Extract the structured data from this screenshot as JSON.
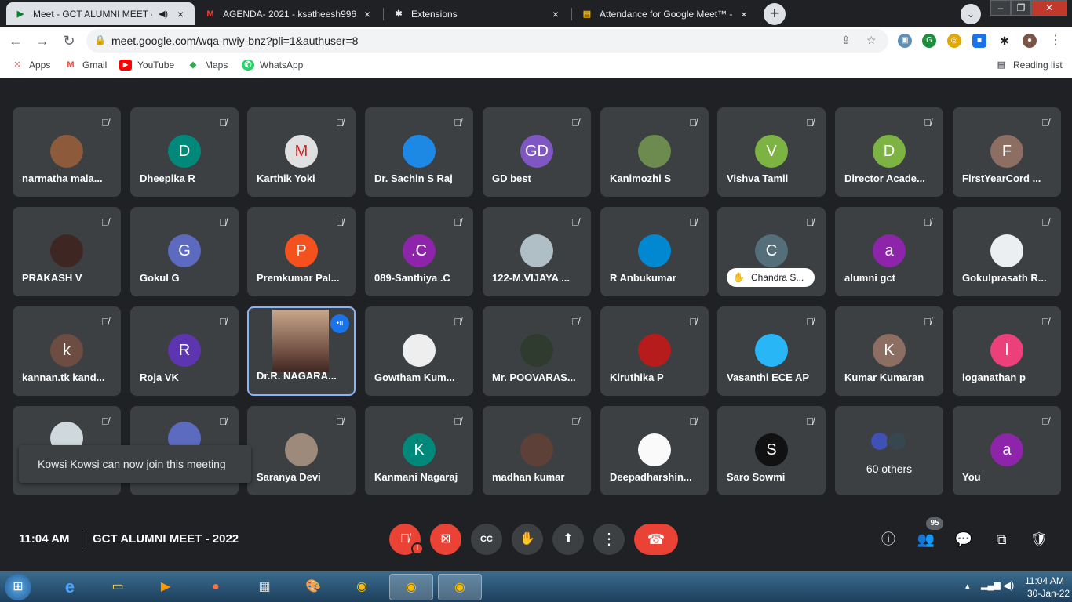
{
  "browser": {
    "tabs": [
      {
        "title": "Meet - GCT ALUMNI MEET -",
        "icon": "meet-icon"
      },
      {
        "title": "AGENDA- 2021 - ksatheesh996@",
        "icon": "gmail-icon"
      },
      {
        "title": "Extensions",
        "icon": "puzzle-icon"
      },
      {
        "title": "Attendance for Google Meet™ -",
        "icon": "attendance-icon"
      }
    ],
    "url": "meet.google.com/wqa-nwiy-bnz?pli=1&authuser=8",
    "bookmarks": [
      {
        "label": "Apps"
      },
      {
        "label": "Gmail"
      },
      {
        "label": "YouTube"
      },
      {
        "label": "Maps"
      },
      {
        "label": "WhatsApp"
      }
    ],
    "reading_list": "Reading list"
  },
  "participants": [
    {
      "name": "narmatha mala...",
      "initial": "",
      "color": "#8d5a3c"
    },
    {
      "name": "Dheepika R",
      "initial": "D",
      "color": "#00897b"
    },
    {
      "name": "Karthik Yoki",
      "initial": "M",
      "color": "#e0e0e0"
    },
    {
      "name": "Dr. Sachin S Raj",
      "initial": "",
      "color": "#1e88e5"
    },
    {
      "name": "GD best",
      "initial": "GD",
      "color": "#7e57c2"
    },
    {
      "name": "Kanimozhi S",
      "initial": "",
      "color": "#6d8b4f"
    },
    {
      "name": "Vishva Tamil",
      "initial": "V",
      "color": "#7cb342"
    },
    {
      "name": "Director Acade...",
      "initial": "D",
      "color": "#7cb342"
    },
    {
      "name": "FirstYearCord ...",
      "initial": "F",
      "color": "#8d6e63"
    },
    {
      "name": "PRAKASH V",
      "initial": "",
      "color": "#3e2723"
    },
    {
      "name": "Gokul G",
      "initial": "G",
      "color": "#5c6bc0"
    },
    {
      "name": "Premkumar Pal...",
      "initial": "P",
      "color": "#f4511e"
    },
    {
      "name": "089-Santhiya .C",
      "initial": ".C",
      "color": "#8e24aa"
    },
    {
      "name": "122-M.VIJAYA ...",
      "initial": "",
      "color": "#b0bec5"
    },
    {
      "name": "R Anbukumar",
      "initial": "",
      "color": "#0288d1"
    },
    {
      "name": "Chandra S...",
      "initial": "C",
      "color": "#546e7a"
    },
    {
      "name": "alumni gct",
      "initial": "a",
      "color": "#8e24aa"
    },
    {
      "name": "Gokulprasath R...",
      "initial": "",
      "color": "#eceff1"
    },
    {
      "name": "kannan.tk kand...",
      "initial": "k",
      "color": "#6d4c41"
    },
    {
      "name": "Roja VK",
      "initial": "R",
      "color": "#5e35b1"
    },
    {
      "name": "Dr.R. NAGARA...",
      "initial": "",
      "color": "#a1887f"
    },
    {
      "name": "Gowtham Kum...",
      "initial": "",
      "color": "#eeeeee"
    },
    {
      "name": "Mr. POOVARAS...",
      "initial": "",
      "color": "#2e3b2e"
    },
    {
      "name": "Kiruthika P",
      "initial": "",
      "color": "#b71c1c"
    },
    {
      "name": "Vasanthi ECE AP",
      "initial": "",
      "color": "#29b6f6"
    },
    {
      "name": "Kumar Kumaran",
      "initial": "K",
      "color": "#8d6e63"
    },
    {
      "name": "loganathan p",
      "initial": "l",
      "color": "#ec407a"
    },
    {
      "name": "",
      "initial": "",
      "color": "#cfd8dc"
    },
    {
      "name": "",
      "initial": "",
      "color": "#5c6bc0"
    },
    {
      "name": "Saranya Devi",
      "initial": "",
      "color": "#9e8a7a"
    },
    {
      "name": "Kanmani Nagaraj",
      "initial": "K",
      "color": "#00897b"
    },
    {
      "name": "madhan kumar",
      "initial": "",
      "color": "#5d4037"
    },
    {
      "name": "Deepadharshin...",
      "initial": "",
      "color": "#fafafa"
    },
    {
      "name": "Saro Sowmi",
      "initial": "S",
      "color": "#111111"
    },
    {
      "name": "60 others",
      "initial": "",
      "color": "#3c4043"
    },
    {
      "name": "You",
      "initial": "a",
      "color": "#8e24aa"
    }
  ],
  "toast": "Kowsi Kowsi can now join this meeting",
  "meeting": {
    "time": "11:04 AM",
    "title": "GCT ALUMNI MEET - 2022",
    "participant_count": "95"
  },
  "taskbar": {
    "time": "11:04 AM",
    "date": "30-Jan-22"
  }
}
